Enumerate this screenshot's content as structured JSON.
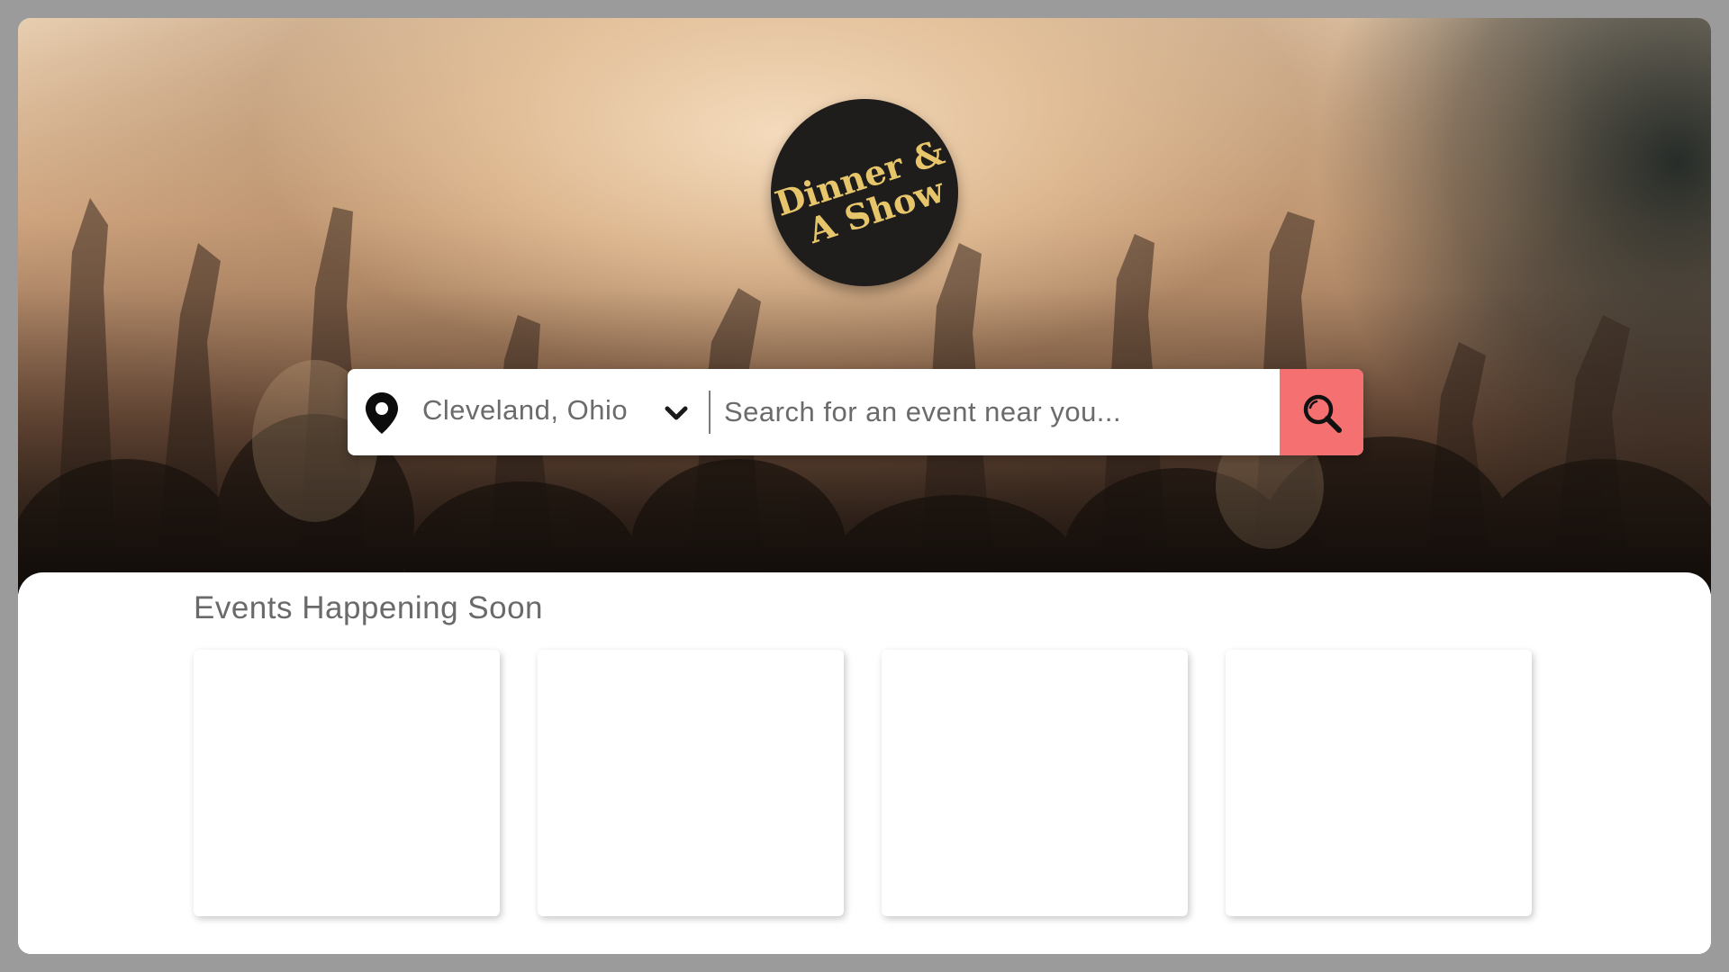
{
  "brand": {
    "logo_line1": "Dinner &",
    "logo_line2": "A Show",
    "logo_color": "#e6c56b",
    "logo_bg": "#1f1d1b"
  },
  "search": {
    "location_icon": "map-pin-icon",
    "location_value": "Cleveland, Ohio",
    "dropdown_icon": "chevron-down-icon",
    "placeholder": "Search for an event near you...",
    "query": "",
    "button_icon": "magnifier-icon",
    "button_color": "#f57070"
  },
  "events": {
    "title": "Events Happening Soon",
    "cards": [
      {},
      {},
      {},
      {}
    ]
  }
}
